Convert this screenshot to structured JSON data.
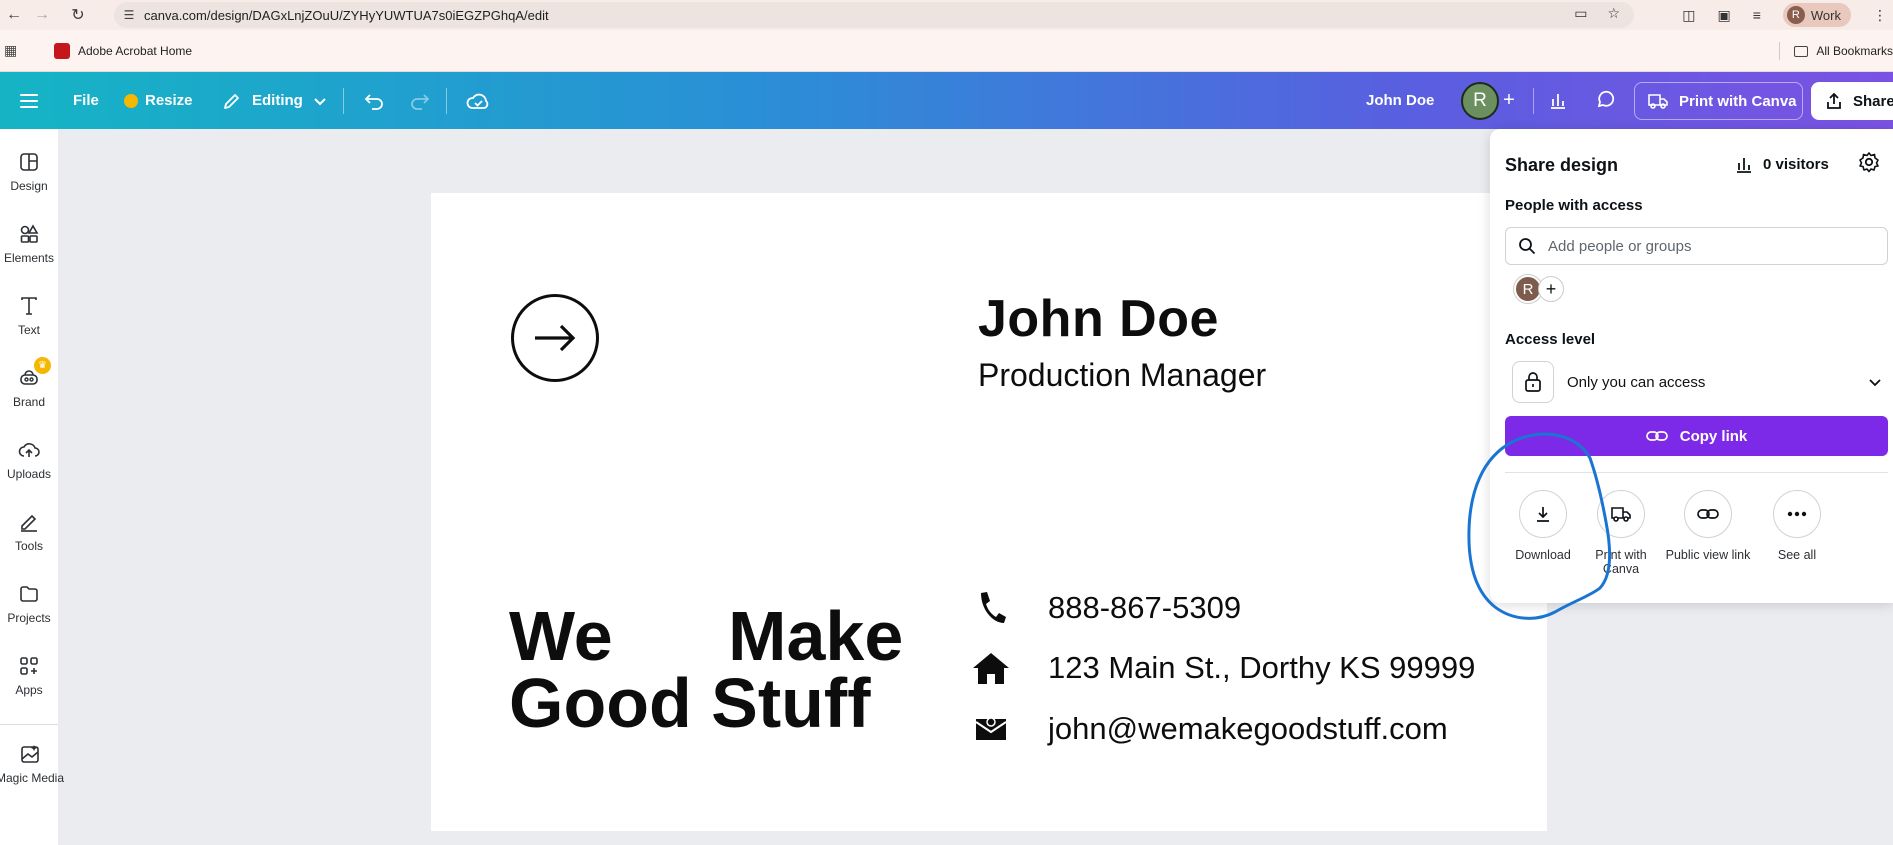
{
  "browser": {
    "url": "canva.com/design/DAGxLnjZOuU/ZYHyYUWTUA7s0iEGZPGhqA/edit",
    "profile_label": "Work",
    "profile_initial": "R"
  },
  "bookmarks": {
    "items": [
      "Adobe Acrobat Home"
    ],
    "all_bookmarks": "All Bookmarks"
  },
  "header": {
    "file": "File",
    "resize": "Resize",
    "editing": "Editing",
    "user_name": "John Doe",
    "avatar_initial": "R",
    "print_with_canva": "Print with Canva",
    "share": "Share"
  },
  "sidebar": {
    "items": [
      {
        "label": "Design",
        "icon": "layout-icon"
      },
      {
        "label": "Elements",
        "icon": "shapes-icon"
      },
      {
        "label": "Text",
        "icon": "text-icon"
      },
      {
        "label": "Brand",
        "icon": "brand-icon"
      },
      {
        "label": "Uploads",
        "icon": "cloud-upload-icon"
      },
      {
        "label": "Tools",
        "icon": "pen-icon"
      },
      {
        "label": "Projects",
        "icon": "folder-icon"
      },
      {
        "label": "Apps",
        "icon": "apps-icon"
      },
      {
        "label": "Magic Media",
        "icon": "magic-media-icon"
      }
    ]
  },
  "card": {
    "name": "John Doe",
    "role": "Production Manager",
    "slogan_line1": "We Make",
    "slogan_line2": "Good Stuff",
    "phone": "888-867-5309",
    "address": "123 Main St., Dorthy KS 99999",
    "email": "john@wemakegoodstuff.com"
  },
  "share_panel": {
    "title": "Share design",
    "visitors": "0 visitors",
    "people_label": "People with access",
    "search_placeholder": "Add people or groups",
    "member_initial": "R",
    "access_label": "Access level",
    "access_value": "Only you can access",
    "copy_link": "Copy link",
    "actions": [
      {
        "label": "Download",
        "icon": "download-icon"
      },
      {
        "label": "Print with Canva",
        "icon": "truck-icon"
      },
      {
        "label": "Public view link",
        "icon": "link-icon"
      },
      {
        "label": "See all",
        "icon": "more-icon"
      }
    ]
  },
  "colors": {
    "header_gradient_start": "#15b4c5",
    "header_gradient_end": "#7b52e3",
    "copy_link": "#7d2ae8",
    "annotation": "#1a75d2"
  }
}
